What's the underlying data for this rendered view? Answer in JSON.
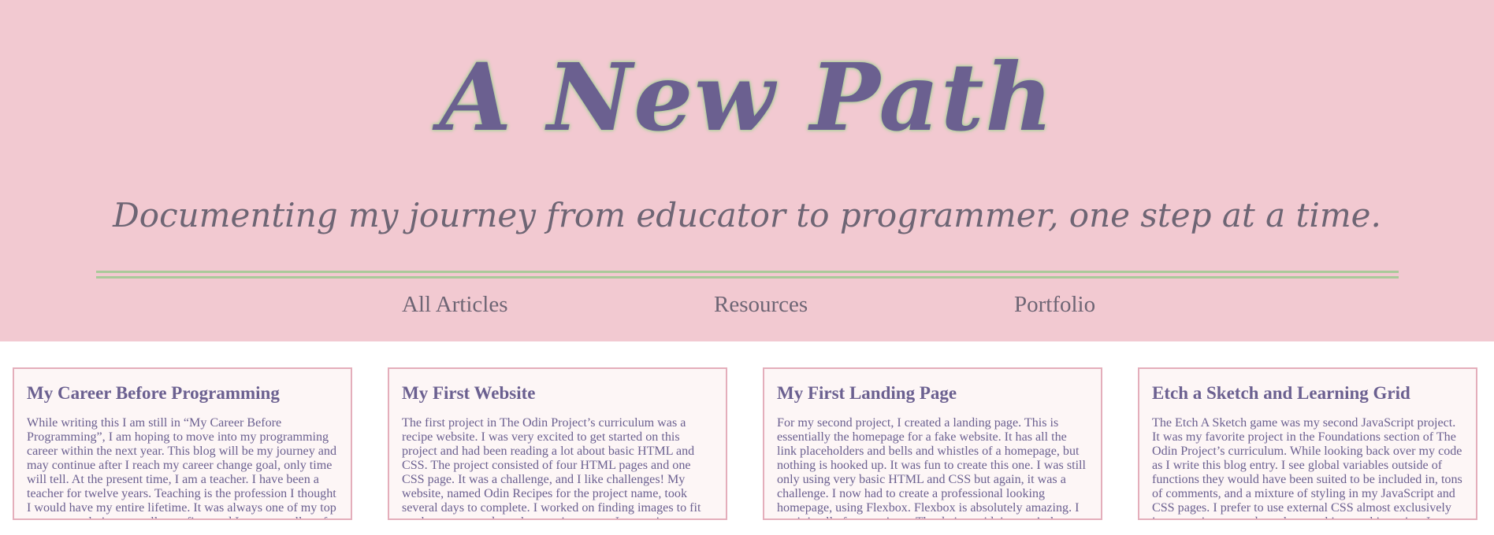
{
  "header": {
    "title": "A New Path",
    "tagline": "Documenting my journey from educator to programmer, one step at a time."
  },
  "nav": {
    "links": [
      {
        "label": "All Articles"
      },
      {
        "label": "Resources"
      },
      {
        "label": "Portfolio"
      }
    ]
  },
  "articles": [
    {
      "title": "My Career Before Programming",
      "excerpt": "While writing this I am still in “My Career Before Programming”, I am hoping to move into my programming career within the next year. This blog will be my journey and may continue after I reach my career change goal, only time will tell. At the present time, I am a teacher. I have been a teacher for twelve years. Teaching is the profession I thought I would have my entire lifetime. It was always one of my top two career choices, usually my first, and I went to college for"
    },
    {
      "title": "My First Website",
      "excerpt": "The first project in The Odin Project’s curriculum was a recipe website. I was very excited to get started on this project and had been reading a lot about basic HTML and CSS. The project consisted of four HTML pages and one CSS page. It was a challenge, and I like challenges! My website, named Odin Recipes for the project name, took several days to complete. I worked on finding images to fit my homepage and my three recipe pages. I spent time planning the perfect color"
    },
    {
      "title": "My First Landing Page",
      "excerpt": "For my second project, I created a landing page. This is essentially the homepage for a fake website. It has all the link placeholders and bells and whistles of a homepage, but nothing is hooked up. It was fun to create this one. I was still only using very basic HTML and CSS but again, it was a challenge. I now had to create a professional looking homepage, using Flexbox. Flexbox is absolutely amazing. I use it in all of my projects. That being said, it wasn’t the"
    },
    {
      "title": "Etch a Sketch and Learning Grid",
      "excerpt": "The Etch A Sketch game was my second JavaScript project. It was my favorite project in the Foundations section of The Odin Project’s curriculum. While looking back over my code as I write this blog entry. I see global variables outside of functions they would have been suited to be included in, tons of comments, and a mixture of styling in my JavaScript and CSS pages. I prefer to use external CSS almost exclusively in my projects now, but when working on this project I didn’t"
    }
  ],
  "colors": {
    "header_background": "#f2c9d1",
    "title_color": "#6b6090",
    "title_glow": "#a9cf98",
    "tagline_color": "#6e6574",
    "divider_color": "#a9c99a",
    "card_border": "#e4aebb",
    "card_background": "#fdf6f6"
  }
}
